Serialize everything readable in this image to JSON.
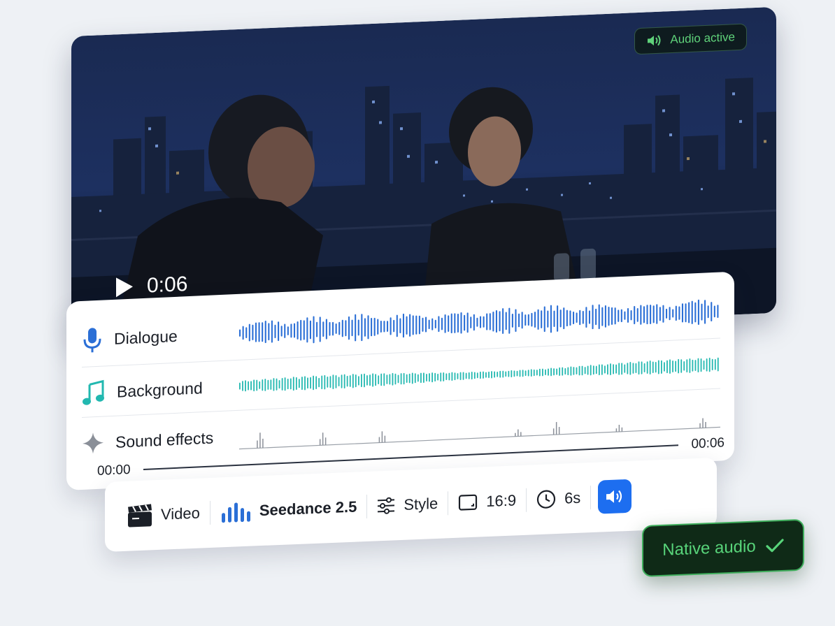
{
  "video": {
    "timestamp": "0:06",
    "play_icon": "play-icon",
    "audio_badge": {
      "label": "Audio active",
      "icon": "speaker-icon",
      "color": "#5fd27a"
    }
  },
  "tracks": [
    {
      "label": "Dialogue",
      "icon": "microphone-icon",
      "color": "#2b6fd6"
    },
    {
      "label": "Background",
      "icon": "music-note-icon",
      "color": "#22b8b0"
    },
    {
      "label": "Sound effects",
      "icon": "sparkle-icon",
      "color": "#8a8f98"
    }
  ],
  "timeline": {
    "start": "00:00",
    "end": "00:06"
  },
  "toolbar": {
    "mode_label": "Video",
    "mode_icon": "clapperboard-icon",
    "model_label": "Seedance 2.5",
    "model_icon": "bars-icon",
    "style_label": "Style",
    "style_icon": "sliders-icon",
    "ratio_label": "16:9",
    "ratio_icon": "aspect-ratio-icon",
    "duration_label": "6s",
    "duration_icon": "clock-icon",
    "audio_toggle_icon": "speaker-icon",
    "accent": "#1d6ef0"
  },
  "native_audio": {
    "label": "Native audio",
    "icon": "check-icon",
    "color": "#58d47a"
  }
}
